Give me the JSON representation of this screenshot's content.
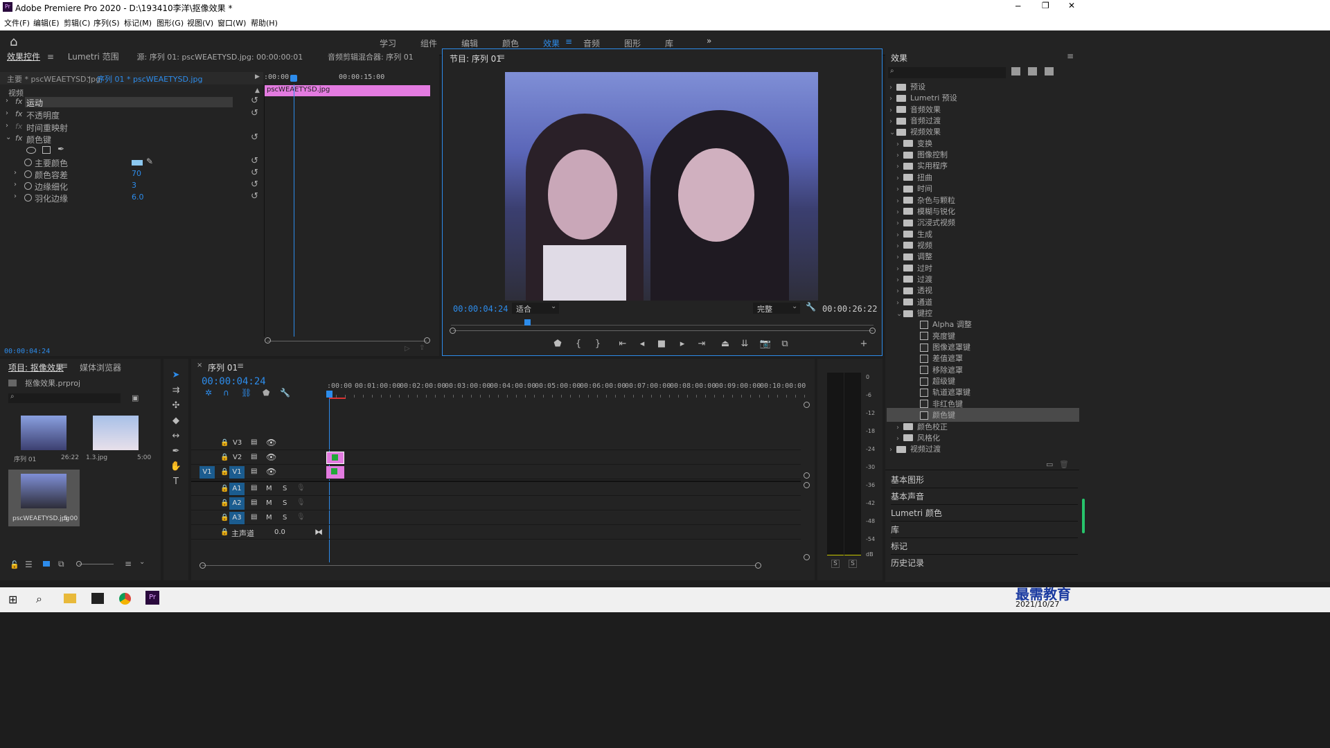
{
  "window": {
    "title": "Adobe Premiere Pro 2020 - D:\\193410李洋\\抠像效果 *",
    "app_icon": "Pr"
  },
  "menu": [
    "文件(F)",
    "编辑(E)",
    "剪辑(C)",
    "序列(S)",
    "标记(M)",
    "图形(G)",
    "视图(V)",
    "窗口(W)",
    "帮助(H)"
  ],
  "workspaces": [
    "学习",
    "组件",
    "编辑",
    "颜色",
    "效果",
    "音频",
    "图形",
    "库"
  ],
  "active_workspace": "效果",
  "effect_controls": {
    "tabs": [
      "效果控件",
      "Lumetri 范围",
      "源: 序列 01: pscWEAETYSD.jpg: 00:00:00:01",
      "音频剪辑混合器: 序列 01"
    ],
    "master": "主要 * pscWEAETYSD.jpg",
    "sequence_clip": "序列 01 * pscWEAETYSD.jpg",
    "ruler_start": ":00:00",
    "ruler_mid": "00:00:15:00",
    "clip_name": "pscWEAETYSD.jpg",
    "section": "视频",
    "fx": [
      "运动",
      "不透明度",
      "时间重映射",
      "颜色键"
    ],
    "params": [
      {
        "name": "主要颜色",
        "value": ""
      },
      {
        "name": "颜色容差",
        "value": "70"
      },
      {
        "name": "边缘细化",
        "value": "3"
      },
      {
        "name": "羽化边缘",
        "value": "6.0"
      }
    ],
    "timecode": "00:00:04:24"
  },
  "program": {
    "title": "节目: 序列 01",
    "timecode": "00:00:04:24",
    "fit": "适合",
    "quality": "完整",
    "duration": "00:00:26:22"
  },
  "effects": {
    "title": "效果",
    "items": [
      {
        "label": "预设",
        "level": 0,
        "open": false
      },
      {
        "label": "Lumetri 预设",
        "level": 0,
        "open": false
      },
      {
        "label": "音频效果",
        "level": 0,
        "open": false
      },
      {
        "label": "音频过渡",
        "level": 0,
        "open": false
      },
      {
        "label": "视频效果",
        "level": 0,
        "open": true
      },
      {
        "label": "变换",
        "level": 1,
        "open": false
      },
      {
        "label": "图像控制",
        "level": 1,
        "open": false
      },
      {
        "label": "实用程序",
        "level": 1,
        "open": false
      },
      {
        "label": "扭曲",
        "level": 1,
        "open": false
      },
      {
        "label": "时间",
        "level": 1,
        "open": false
      },
      {
        "label": "杂色与颗粒",
        "level": 1,
        "open": false
      },
      {
        "label": "模糊与锐化",
        "level": 1,
        "open": false
      },
      {
        "label": "沉浸式视频",
        "level": 1,
        "open": false
      },
      {
        "label": "生成",
        "level": 1,
        "open": false
      },
      {
        "label": "视频",
        "level": 1,
        "open": false
      },
      {
        "label": "调整",
        "level": 1,
        "open": false
      },
      {
        "label": "过时",
        "level": 1,
        "open": false
      },
      {
        "label": "过渡",
        "level": 1,
        "open": false
      },
      {
        "label": "透视",
        "level": 1,
        "open": false
      },
      {
        "label": "通道",
        "level": 1,
        "open": false
      },
      {
        "label": "键控",
        "level": 1,
        "open": true
      },
      {
        "label": "Alpha 调整",
        "level": 2
      },
      {
        "label": "亮度键",
        "level": 2
      },
      {
        "label": "图像遮罩键",
        "level": 2
      },
      {
        "label": "差值遮罩",
        "level": 2
      },
      {
        "label": "移除遮罩",
        "level": 2
      },
      {
        "label": "超级键",
        "level": 2
      },
      {
        "label": "轨道遮罩键",
        "level": 2
      },
      {
        "label": "非红色键",
        "level": 2
      },
      {
        "label": "颜色键",
        "level": 2,
        "selected": true
      },
      {
        "label": "颜色校正",
        "level": 1,
        "open": false
      },
      {
        "label": "风格化",
        "level": 1,
        "open": false
      },
      {
        "label": "视频过渡",
        "level": 0,
        "open": false
      }
    ],
    "panels": [
      "基本图形",
      "基本声音",
      "Lumetri 颜色",
      "库",
      "标记",
      "历史记录"
    ]
  },
  "project": {
    "tabs": [
      "项目: 抠像效果",
      "媒体浏览器"
    ],
    "file": "抠像效果.prproj",
    "items": [
      {
        "name": "序列 01",
        "dur": "26:22"
      },
      {
        "name": "1.3.jpg",
        "dur": "5:00"
      },
      {
        "name": "pscWEAETYSD.jpg",
        "dur": "5:00"
      }
    ]
  },
  "timeline": {
    "tab": "序列 01",
    "timecode": "00:00:04:24",
    "ruler": [
      ":00:00",
      "00:01:00:00",
      "00:02:00:00",
      "00:03:00:00",
      "00:04:00:00",
      "00:05:00:00",
      "00:06:00:00",
      "00:07:00:00",
      "00:08:00:00",
      "00:09:00:00",
      "00:10:00:00"
    ],
    "video_tracks": [
      "V3",
      "V2",
      "V1"
    ],
    "audio_tracks": [
      "A1",
      "A2",
      "A3"
    ],
    "master": "主声道",
    "master_val": "0.0",
    "src_v": "V1"
  },
  "meter": {
    "scale": [
      "0",
      "-6",
      "-12",
      "-18",
      "-24",
      "-30",
      "-36",
      "-42",
      "-48",
      "-54",
      "dB"
    ],
    "solo": "S"
  },
  "taskbar": {
    "time": "2021/10/27",
    "watermark": "最需教育"
  }
}
